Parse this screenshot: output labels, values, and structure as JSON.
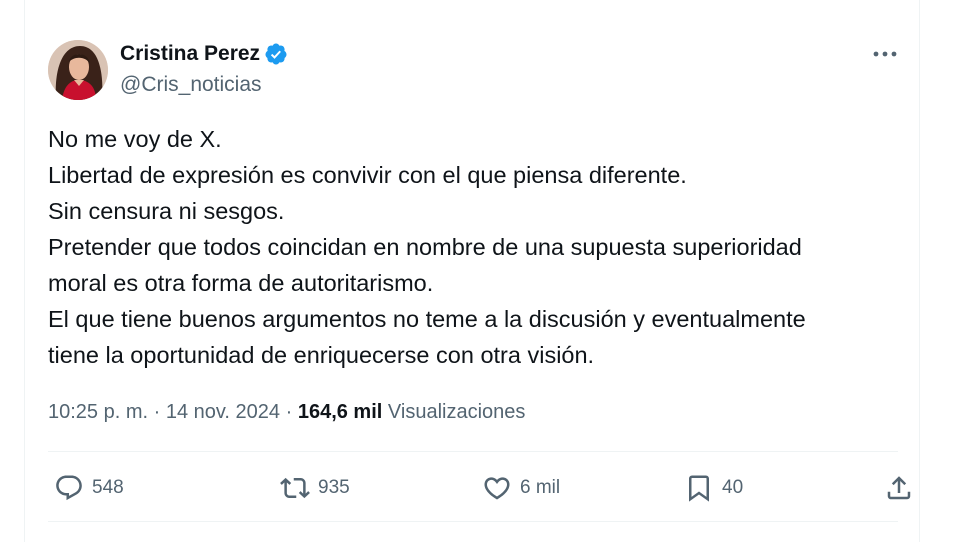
{
  "author": {
    "name": "Cristina Perez",
    "handle": "@Cris_noticias"
  },
  "tweet": {
    "lines": [
      "No me voy de X.",
      "Libertad de expresión es convivir con el que piensa diferente.",
      "Sin censura ni sesgos.",
      "Pretender que todos coincidan en nombre de una supuesta superioridad",
      "moral es otra forma de autoritarismo.",
      "El que tiene buenos argumentos no teme a la discusión y eventualmente",
      "tiene la oportunidad de enriquecerse con otra visión."
    ]
  },
  "meta": {
    "time": "10:25 p. m.",
    "sep1": "·",
    "date": "14 nov. 2024",
    "sep2": "·",
    "views_count": "164,6 mil",
    "views_label": "Visualizaciones"
  },
  "actions": {
    "replies": "548",
    "reposts": "935",
    "likes": "6 mil",
    "bookmarks": "40"
  },
  "colors": {
    "text": "#0f1419",
    "secondary": "#536471",
    "verified": "#1d9bf0",
    "divider": "#eff3f4"
  },
  "icons": [
    "avatar-photo",
    "verified-badge-icon",
    "more-icon",
    "reply-icon",
    "repost-icon",
    "like-icon",
    "bookmark-icon",
    "share-icon"
  ]
}
